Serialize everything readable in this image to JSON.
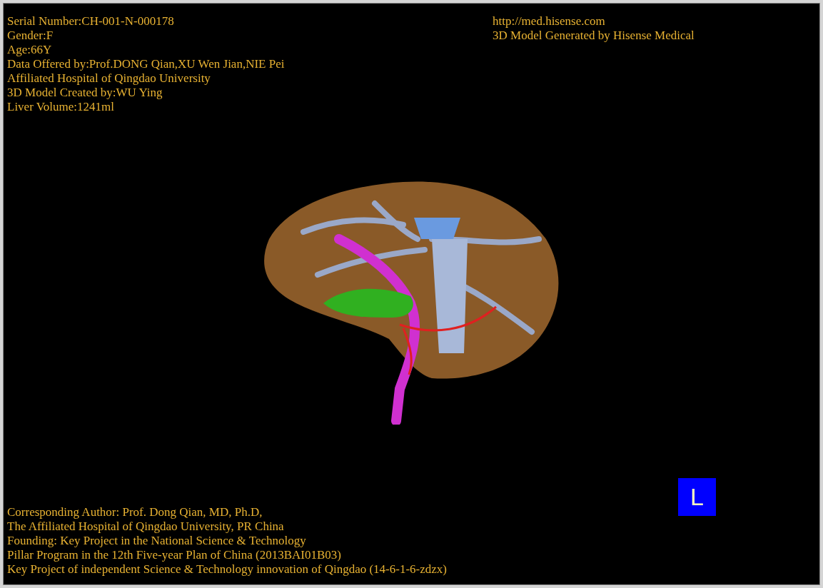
{
  "patient_info": [
    "Serial Number:CH-001-N-000178",
    "Gender:F",
    "Age:66Y",
    "Data Offered by:Prof.DONG Qian,XU Wen Jian,NIE Pei",
    "Affiliated Hospital of Qingdao University",
    "3D Model Created by:WU Ying",
    "Liver Volume:1241ml"
  ],
  "source_info": [
    "http://med.hisense.com",
    "3D Model Generated by Hisense Medical"
  ],
  "credits": [
    "Corresponding Author: Prof. Dong Qian, MD, Ph.D,",
    "The Affiliated Hospital of Qingdao University, PR China",
    "Founding: Key Project in the National Science & Technology",
    "Pillar Program in the 12th Five-year Plan of China (2013BAI01B03)",
    "Key Project of independent Science & Technology innovation of Qingdao (14-6-1-6-zdzx)"
  ],
  "orientation_badge": "L"
}
